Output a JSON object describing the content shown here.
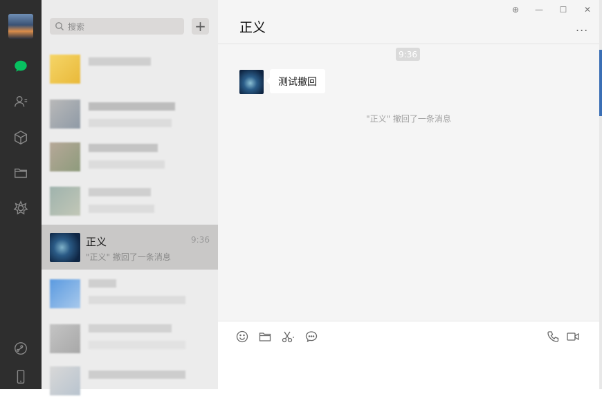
{
  "search": {
    "placeholder": "搜索"
  },
  "list_add_label": "+",
  "chat_list": {
    "active_item": {
      "name": "正义",
      "time": "9:36",
      "preview": "\"正义\" 撤回了一条消息"
    }
  },
  "chat": {
    "title": "正义",
    "more_label": "...",
    "window_controls": {
      "pin": "⊕",
      "minimize": "—",
      "maximize": "☐",
      "close": "✕"
    },
    "timestamp": "9:36",
    "messages": [
      {
        "text": "测试撤回"
      }
    ],
    "system_notice": "\"正义\" 撤回了一条消息"
  },
  "icons": {
    "nav": [
      "chat-icon",
      "contacts-icon",
      "favorites-cube-icon",
      "files-folder-icon",
      "moments-icon",
      "mini-programs-icon",
      "phone-icon"
    ],
    "toolbar": [
      "emoji-icon",
      "folder-icon",
      "scissors-icon",
      "chat-history-icon",
      "voice-call-icon",
      "video-call-icon"
    ]
  },
  "colors": {
    "nav_bg": "#2e2e2e",
    "accent_green": "#07c160",
    "active_item": "#c9c8c7",
    "chat_bg": "#f5f5f5"
  }
}
